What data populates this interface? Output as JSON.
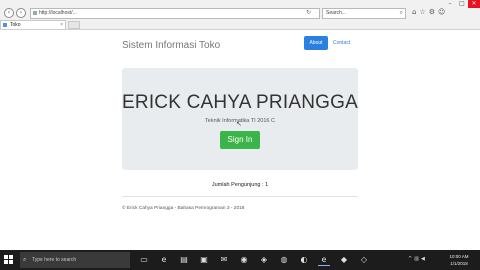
{
  "browser": {
    "address": "http://localhost/...",
    "search_placeholder": "Search...",
    "tab_title": "Toko",
    "tab_close": "×",
    "min": "–",
    "max": "□",
    "close": "✕"
  },
  "page": {
    "brand": "Sistem Informasi Toko",
    "nav": {
      "about": "About",
      "contact": "Contact"
    },
    "jumbotron": {
      "title": "ERICK CAHYA PRIANGGA",
      "subtitle": "Teknik Informatika TI 2016 C",
      "signin": "Sign In"
    },
    "visitor": "Jumlah Pengunjung : 1",
    "footer": "© Erick Cahya Priangga - Bahasa Pemrograman 3 - 2018"
  },
  "taskbar": {
    "search_placeholder": "Type here to search",
    "time": "10:00 AM",
    "date": "1/1/2018"
  },
  "colors": {
    "primary": "#2a7fe0",
    "success": "#3bb54a",
    "jumbotron_bg": "#e9ecef"
  }
}
